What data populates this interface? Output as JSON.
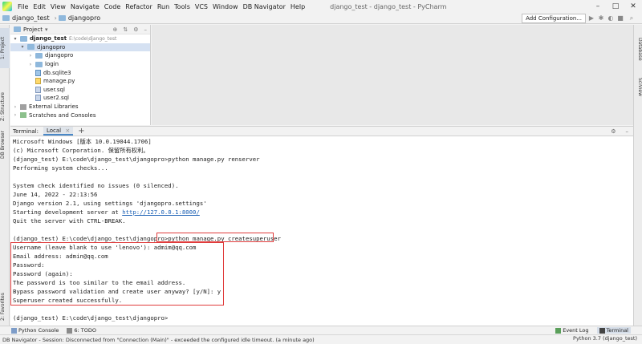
{
  "menu": {
    "items": [
      "File",
      "Edit",
      "View",
      "Navigate",
      "Code",
      "Refactor",
      "Run",
      "Tools",
      "VCS",
      "Window",
      "DB Navigator",
      "Help"
    ],
    "title": "django_test - django_test - PyCharm"
  },
  "breadcrumb": {
    "root": "django_test",
    "child": "djangopro"
  },
  "toolbar": {
    "add_config": "Add Configuration..."
  },
  "left_strip": {
    "project": "1: Project",
    "structure": "Z: Structure",
    "db_browser": "DB Browser",
    "favorites": "2: Favorites"
  },
  "right_strip": {
    "database": "Database",
    "sciview": "SciView"
  },
  "project": {
    "header": "Project",
    "root_name": "django_test",
    "root_path": "E:\\code\\django_test",
    "items": [
      {
        "label": "djangopro"
      },
      {
        "label": "djangopro"
      },
      {
        "label": "login"
      },
      {
        "label": "db.sqlite3"
      },
      {
        "label": "manage.py"
      },
      {
        "label": "user.sql"
      },
      {
        "label": "user2.sql"
      }
    ],
    "external": "External Libraries",
    "scratches": "Scratches and Consoles"
  },
  "terminal": {
    "tab_label": "Terminal:",
    "local_tab": "Local",
    "lines": [
      "Microsoft Windows [版本 10.0.19044.1706]",
      "(c) Microsoft Corporation. 保留所有权利。",
      "(django_test) E:\\code\\django_test\\djangopro>python manage.py renserver",
      "Performing system checks...",
      "",
      "System check identified no issues (0 silenced).",
      "June 14, 2022 - 22:13:56",
      "Django version 2.1, using settings 'djangopro.settings'",
      "Starting development server at ",
      "Quit the server with CTRL-BREAK.",
      "",
      "(django_test) E:\\code\\django_test\\djangopro>python manage.py createsuperuser",
      "Username (leave blank to use 'lenovo'): admim@qq.com",
      "Email address: admin@qq.com",
      "Password:",
      "Password (again):",
      "The password is too similar to the email address.",
      "Bypass password validation and create user anyway? [y/N]: y",
      "Superuser created successfully.",
      "",
      "(django_test) E:\\code\\django_test\\djangopro>"
    ],
    "server_url": "http://127.0.0.1:8000/"
  },
  "bottom": {
    "python_console": "Python Console",
    "todo": "6: TODO",
    "event_log": "Event Log",
    "terminal": "Terminal"
  },
  "status": {
    "message": "DB Navigator - Session: Disconnected from \"Connection (Main)\" - exceeded the configured idle timeout. (a minute ago)",
    "interpreter": "Python 3.7 (django_test)"
  }
}
